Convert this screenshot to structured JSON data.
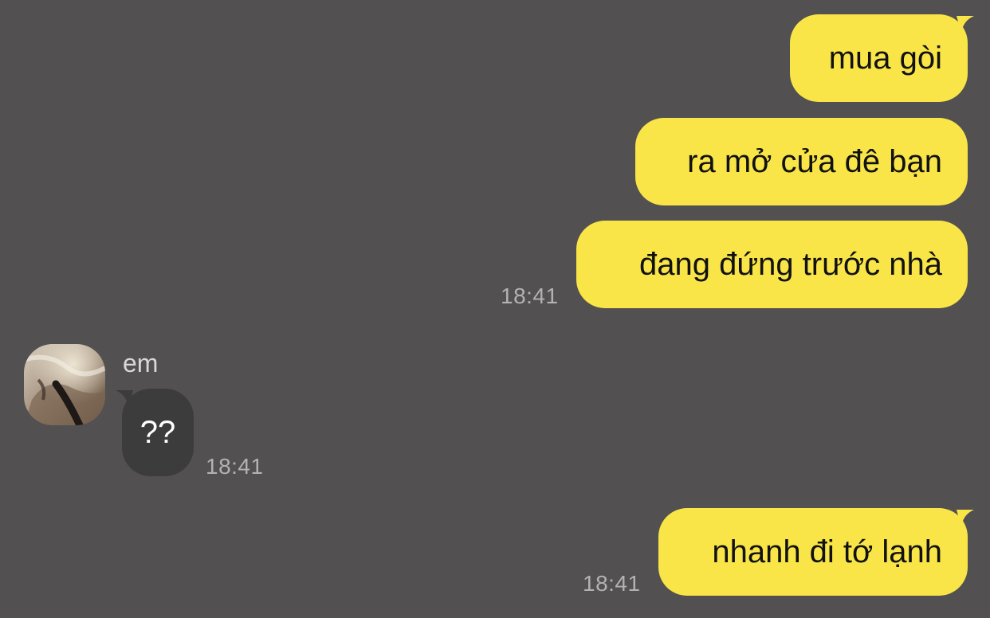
{
  "conversation": {
    "messages": [
      {
        "direction": "outgoing",
        "text": "mua gòi"
      },
      {
        "direction": "outgoing",
        "text": "ra mở cửa đê bạn"
      },
      {
        "direction": "outgoing",
        "text": "đang đứng trước nhà",
        "time": "18:41"
      },
      {
        "direction": "incoming",
        "sender": "em",
        "text": "??",
        "time": "18:41"
      },
      {
        "direction": "outgoing",
        "text": "nhanh đi tớ lạnh",
        "time": "18:41"
      }
    ]
  },
  "colors": {
    "background": "#525051",
    "outgoing_bubble": "#f9e547",
    "incoming_bubble": "#3d3c3d",
    "timestamp": "#b3b1b2"
  },
  "icons": {
    "avatar": "profile-photo"
  }
}
